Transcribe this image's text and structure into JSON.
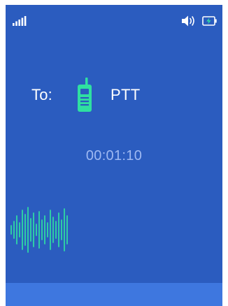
{
  "status_bar": {
    "signal_icon": "signal-bars-icon",
    "volume_icon": "speaker-volume-icon",
    "battery_icon": "battery-charging-icon"
  },
  "call": {
    "to_label": "To:",
    "recipient_icon": "walkie-talkie-icon",
    "recipient": "PTT",
    "timer": "00:01:10"
  },
  "voice_activity_icon": "voice-waveform-icon",
  "colors": {
    "background": "#2b5cbf",
    "bottom_bar": "#3e77df",
    "accent_green": "#2fe0a1",
    "timer_text": "#9fb9f2",
    "text": "#ffffff"
  }
}
